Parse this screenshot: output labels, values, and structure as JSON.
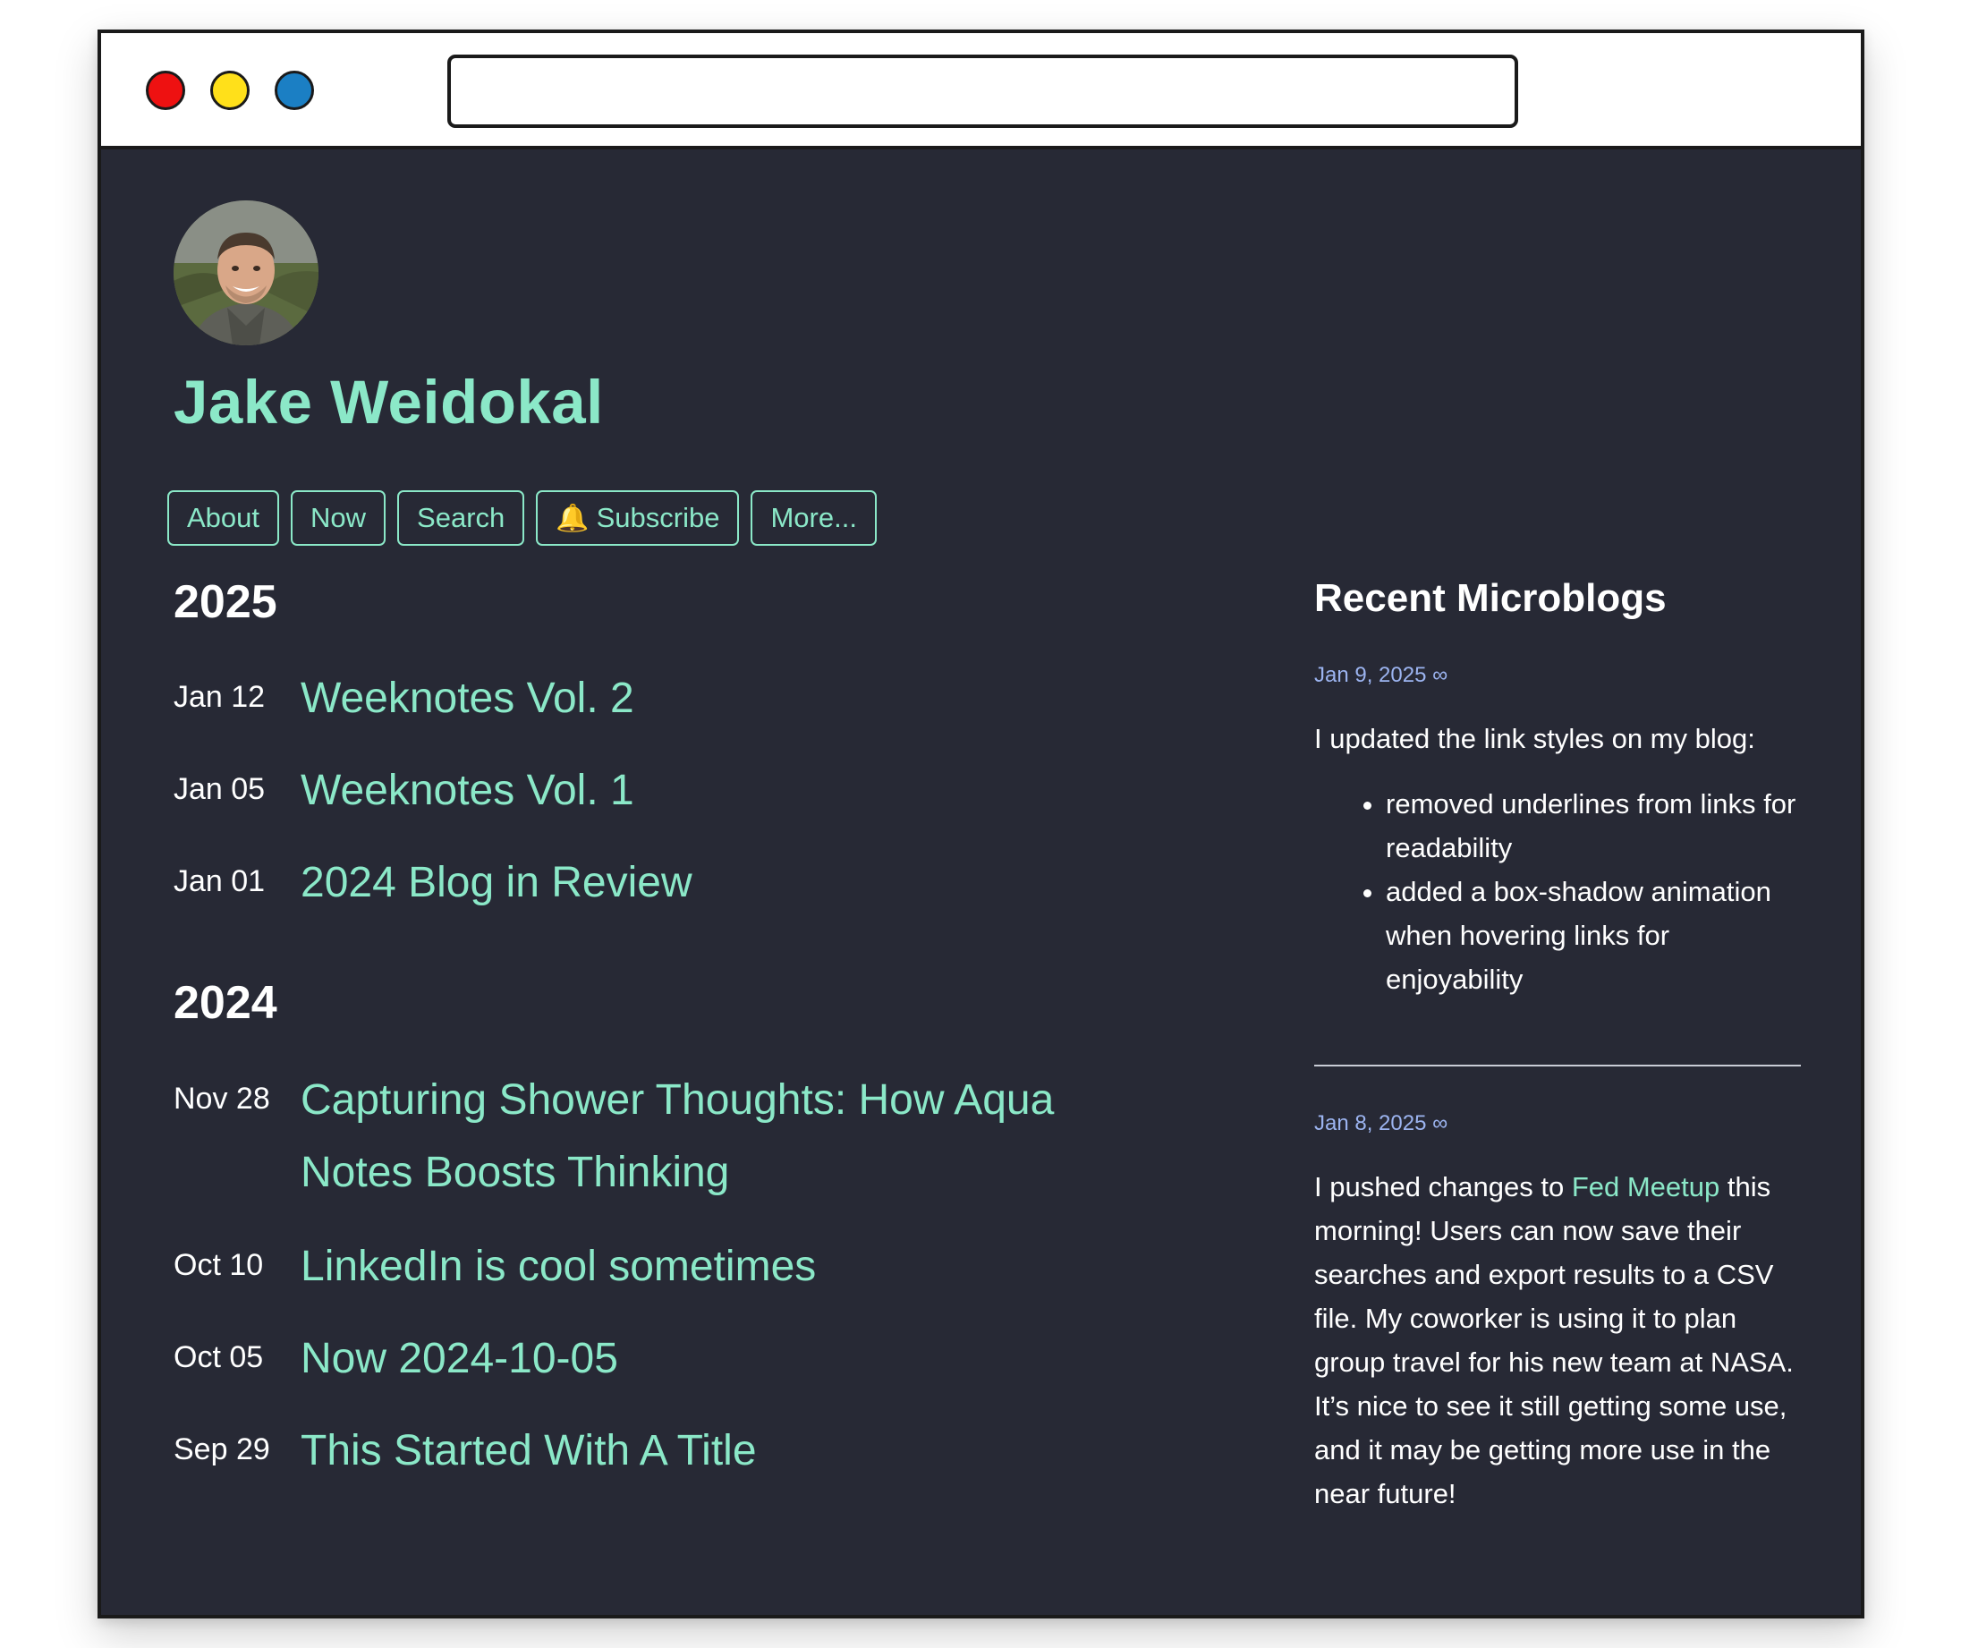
{
  "site": {
    "title": "Jake Weidokal",
    "avatar_alt": "avatar"
  },
  "nav": {
    "about": "About",
    "now": "Now",
    "search": "Search",
    "subscribe": "Subscribe",
    "subscribe_icon": "🔔",
    "more": "More..."
  },
  "posts": {
    "year_2025": "2025",
    "year_2024": "2024",
    "items_2025": [
      {
        "date": "Jan 12",
        "title": "Weeknotes Vol. 2"
      },
      {
        "date": "Jan 05",
        "title": "Weeknotes Vol. 1"
      },
      {
        "date": "Jan 01",
        "title": "2024 Blog in Review"
      }
    ],
    "items_2024": [
      {
        "date": "Nov 28",
        "title": "Capturing Shower Thoughts: How Aqua Notes Boosts Thinking"
      },
      {
        "date": "Oct 10",
        "title": "LinkedIn is cool sometimes"
      },
      {
        "date": "Oct 05",
        "title": "Now 2024-10-05"
      },
      {
        "date": "Sep 29",
        "title": "This Started With A Title"
      }
    ]
  },
  "sidebar": {
    "heading": "Recent Microblogs",
    "microblogs": [
      {
        "date": "Jan 9, 2025 ∞",
        "intro": "I updated the link styles on my blog:",
        "bullets": [
          "removed underlines from links for readability",
          "added a box-shadow animation when hovering links for enjoyability"
        ]
      },
      {
        "date": "Jan 8, 2025 ∞",
        "text_before": "I pushed changes to ",
        "link": "Fed Meetup",
        "text_after": " this morning! Users can now save their searches and export results to a CSV file. My coworker is using it to plan group travel for his new team at NASA. It’s nice to see it still getting some use, and it may be getting more use in the near future!"
      }
    ]
  },
  "colors": {
    "background": "#272935",
    "accent": "#8be8c8",
    "date_link": "#9cb4f0",
    "text": "#ffffff"
  }
}
